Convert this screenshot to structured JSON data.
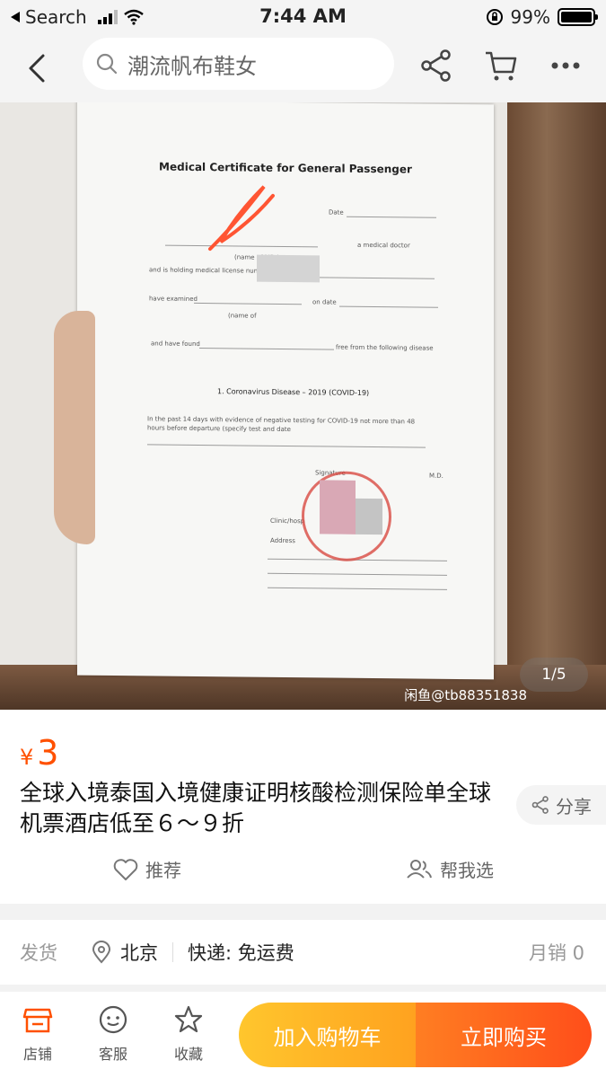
{
  "status_bar": {
    "back_label": "Search",
    "time": "7:44 AM",
    "battery": "99%"
  },
  "nav": {
    "search_placeholder": "潮流帆布鞋女",
    "icons": [
      "back-icon",
      "search-icon",
      "share-icon",
      "cart-icon",
      "more-icon"
    ]
  },
  "gallery": {
    "doc_title": "Medical Certificate for General Passenger",
    "doc_lines": {
      "date": "Date",
      "name_md": "(name of MD.)",
      "medical_doctor": "a medical doctor",
      "license": "and is holding medical license number",
      "examined": "have examined",
      "on_date": "on date",
      "name_of": "(name of",
      "found": "and have found",
      "free_from": "free from the following disease",
      "disease": "1.   Coronavirus Disease – 2019 (COVID-19)",
      "past14_a": "In the past 14 days with evidence of negative testing for COVID-19 not more than 48",
      "past14_b": "hours before departure (specify test and date",
      "signature": "Signature",
      "md": "M.D.",
      "clinic": "Clinic/hosp",
      "address": "Address"
    },
    "watermark": "闲鱼@tb88351838",
    "page_indicator": "1/5"
  },
  "product": {
    "currency": "¥",
    "price": "3",
    "title": "全球入境泰国入境健康证明核酸检测保险单全球机票酒店低至６～９折",
    "share_label": "分享",
    "recommend_label": "推荐",
    "help_choose_label": "帮我选"
  },
  "delivery": {
    "label": "发货",
    "location": "北京",
    "shipping": "快递: 免运费",
    "monthly_sales": "月销 0"
  },
  "bottom_bar": {
    "shop_label": "店铺",
    "service_label": "客服",
    "favorite_label": "收藏",
    "add_cart_label": "加入购物车",
    "buy_now_label": "立即购买"
  },
  "colors": {
    "accent": "#ff5000",
    "cart_button": "#ffb421",
    "buy_button": "#ff5c1c"
  }
}
